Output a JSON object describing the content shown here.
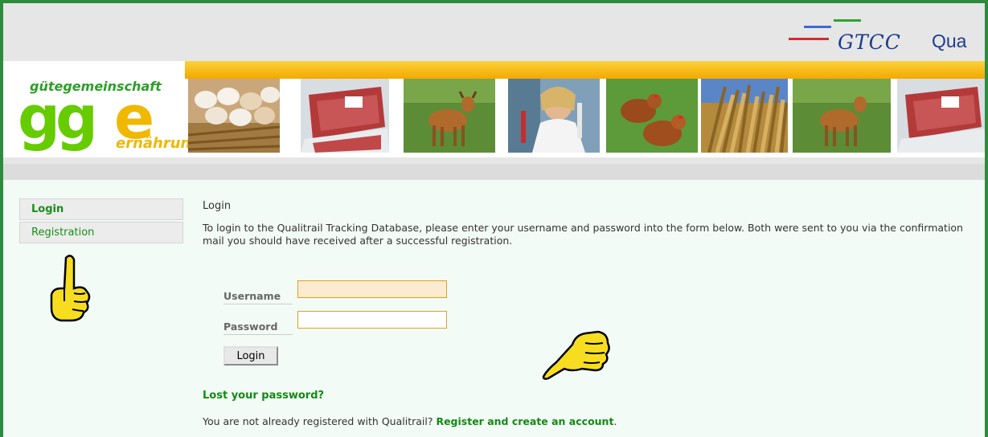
{
  "header": {
    "gtcc_text": "GTCC",
    "qua_text": "Qua"
  },
  "logo": {
    "top": "gütegemeinschaft",
    "gg": "gg",
    "e": "e",
    "bottom": "ernährung"
  },
  "banner_photos": [
    "eggs",
    "meat",
    "deer",
    "lab",
    "chickens",
    "wheat",
    "deer",
    "meat"
  ],
  "sidebar": {
    "items": [
      {
        "label": "Login"
      },
      {
        "label": "Registration"
      }
    ]
  },
  "main": {
    "title": "Login",
    "intro": "To login to the Qualitrail Tracking Database, please enter your username and password into the form below. Both were sent to you via the confirmation mail you should have received after a successful registration.",
    "username_label": "Username",
    "password_label": "Password",
    "username_value": "",
    "password_value": "",
    "login_button": "Login",
    "lost_password": "Lost your password?",
    "register_prefix": "You are not already registered with Qualitrail? ",
    "register_link": "Register and create an account",
    "register_suffix": "."
  },
  "colors": {
    "frame": "#2e8b3e",
    "link": "#128a12",
    "logo_green": "#66cc00",
    "logo_yellow": "#f0b800"
  },
  "icons": [
    "pointing-hand-up-icon",
    "pointing-hand-left-icon"
  ]
}
